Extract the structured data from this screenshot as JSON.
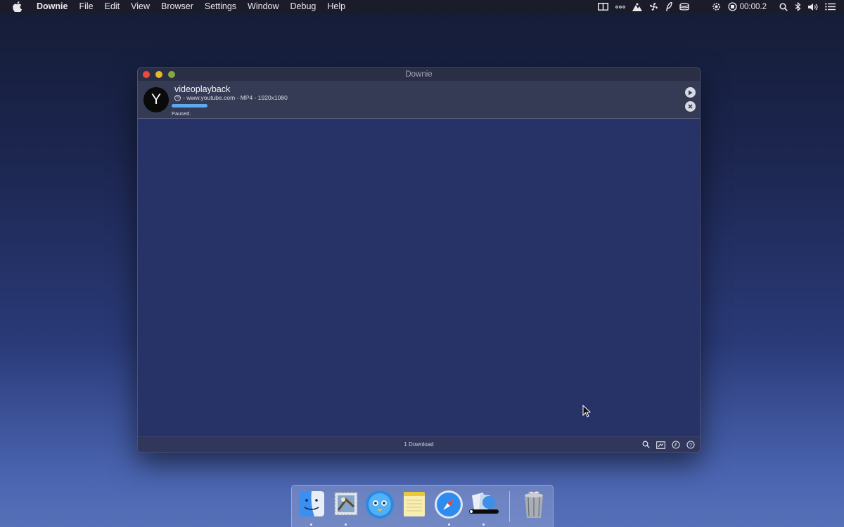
{
  "menubar": {
    "app_name": "Downie",
    "items": [
      "File",
      "Edit",
      "View",
      "Browser",
      "Settings",
      "Window",
      "Debug",
      "Help"
    ],
    "recording_time": "00:00.2"
  },
  "window": {
    "title": "Downie",
    "download": {
      "avatar_letter": "Y",
      "title": "videoplayback",
      "meta": "- www.youtube.com - MP4 - 1920x1080",
      "status": "Paused.",
      "progress_percent": 100
    },
    "footer": {
      "count_label": "1 Download"
    }
  },
  "colors": {
    "progress": "#5fa7ef",
    "close": "#e9493f",
    "minimize": "#e6b92d",
    "zoom": "#8aa83c"
  },
  "dock": {
    "apps": [
      "finder-icon",
      "mail-icon",
      "tweetbot-icon",
      "notes-icon",
      "safari-icon",
      "preview-icon",
      "trash-icon"
    ]
  }
}
